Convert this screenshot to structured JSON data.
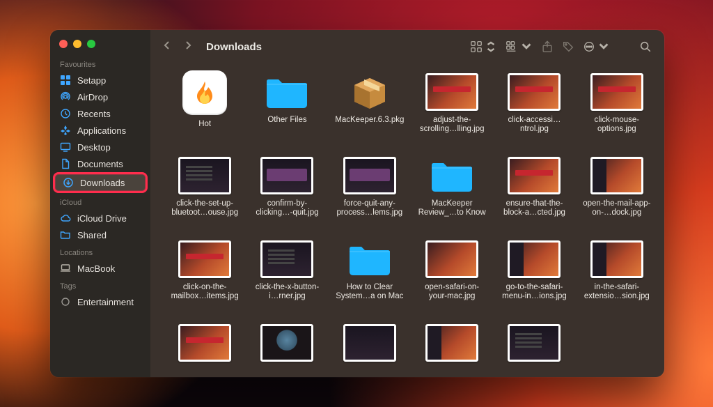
{
  "window": {
    "title": "Downloads"
  },
  "sidebar": {
    "sections": [
      {
        "label": "Favourites",
        "items": [
          {
            "icon": "grid",
            "label": "Setapp"
          },
          {
            "icon": "airdrop",
            "label": "AirDrop"
          },
          {
            "icon": "clock",
            "label": "Recents"
          },
          {
            "icon": "apps",
            "label": "Applications"
          },
          {
            "icon": "desktop",
            "label": "Desktop"
          },
          {
            "icon": "doc",
            "label": "Documents"
          },
          {
            "icon": "download",
            "label": "Downloads",
            "selected": true,
            "highlighted": true
          }
        ]
      },
      {
        "label": "iCloud",
        "items": [
          {
            "icon": "cloud",
            "label": "iCloud Drive"
          },
          {
            "icon": "folder",
            "label": "Shared"
          }
        ]
      },
      {
        "label": "Locations",
        "items": [
          {
            "icon": "laptop",
            "label": "MacBook"
          }
        ]
      },
      {
        "label": "Tags",
        "items": [
          {
            "icon": "tagcircle",
            "label": "Entertainment"
          }
        ]
      }
    ]
  },
  "files": [
    {
      "kind": "app",
      "name": "Hot"
    },
    {
      "kind": "folder",
      "name": "Other Files"
    },
    {
      "kind": "pkg",
      "name": "MacKeeper.6.3.pkg"
    },
    {
      "kind": "img",
      "style": "redbar",
      "name": "adjust-the-scrolling…lling.jpg"
    },
    {
      "kind": "img",
      "style": "redbar",
      "name": "click-accessi…ntrol.jpg"
    },
    {
      "kind": "img",
      "style": "redbar",
      "name": "click-mouse-options.jpg"
    },
    {
      "kind": "img",
      "style": "dark lines",
      "name": "click-the-set-up-bluetoot…ouse.jpg"
    },
    {
      "kind": "img",
      "style": "dark panel",
      "name": "confirm-by-clicking…-quit.jpg"
    },
    {
      "kind": "img",
      "style": "dark panel",
      "name": "force-quit-any-process…lems.jpg"
    },
    {
      "kind": "folder",
      "name": "MacKeeper Review_…to Know"
    },
    {
      "kind": "img",
      "style": "redbar",
      "name": "ensure-that-the-block-a…cted.jpg"
    },
    {
      "kind": "img",
      "style": "sidebar",
      "name": "open-the-mail-app-on-…dock.jpg"
    },
    {
      "kind": "img",
      "style": "redbar",
      "name": "click-on-the-mailbox…items.jpg"
    },
    {
      "kind": "img",
      "style": "dark lines",
      "name": "click-the-x-button-i…rner.jpg"
    },
    {
      "kind": "folder",
      "name": "How to Clear System…a on Mac"
    },
    {
      "kind": "img",
      "style": "",
      "name": "open-safari-on-your-mac.jpg"
    },
    {
      "kind": "img",
      "style": "sidebar",
      "name": "go-to-the-safari-menu-in…ions.jpg"
    },
    {
      "kind": "img",
      "style": "sidebar",
      "name": "in-the-safari-extensio…sion.jpg"
    },
    {
      "kind": "img",
      "style": "redbar",
      "name": ""
    },
    {
      "kind": "img",
      "style": "globe",
      "name": ""
    },
    {
      "kind": "img",
      "style": "dark",
      "name": ""
    },
    {
      "kind": "img",
      "style": "sidebar",
      "name": ""
    },
    {
      "kind": "img",
      "style": "dark lines",
      "name": ""
    }
  ]
}
